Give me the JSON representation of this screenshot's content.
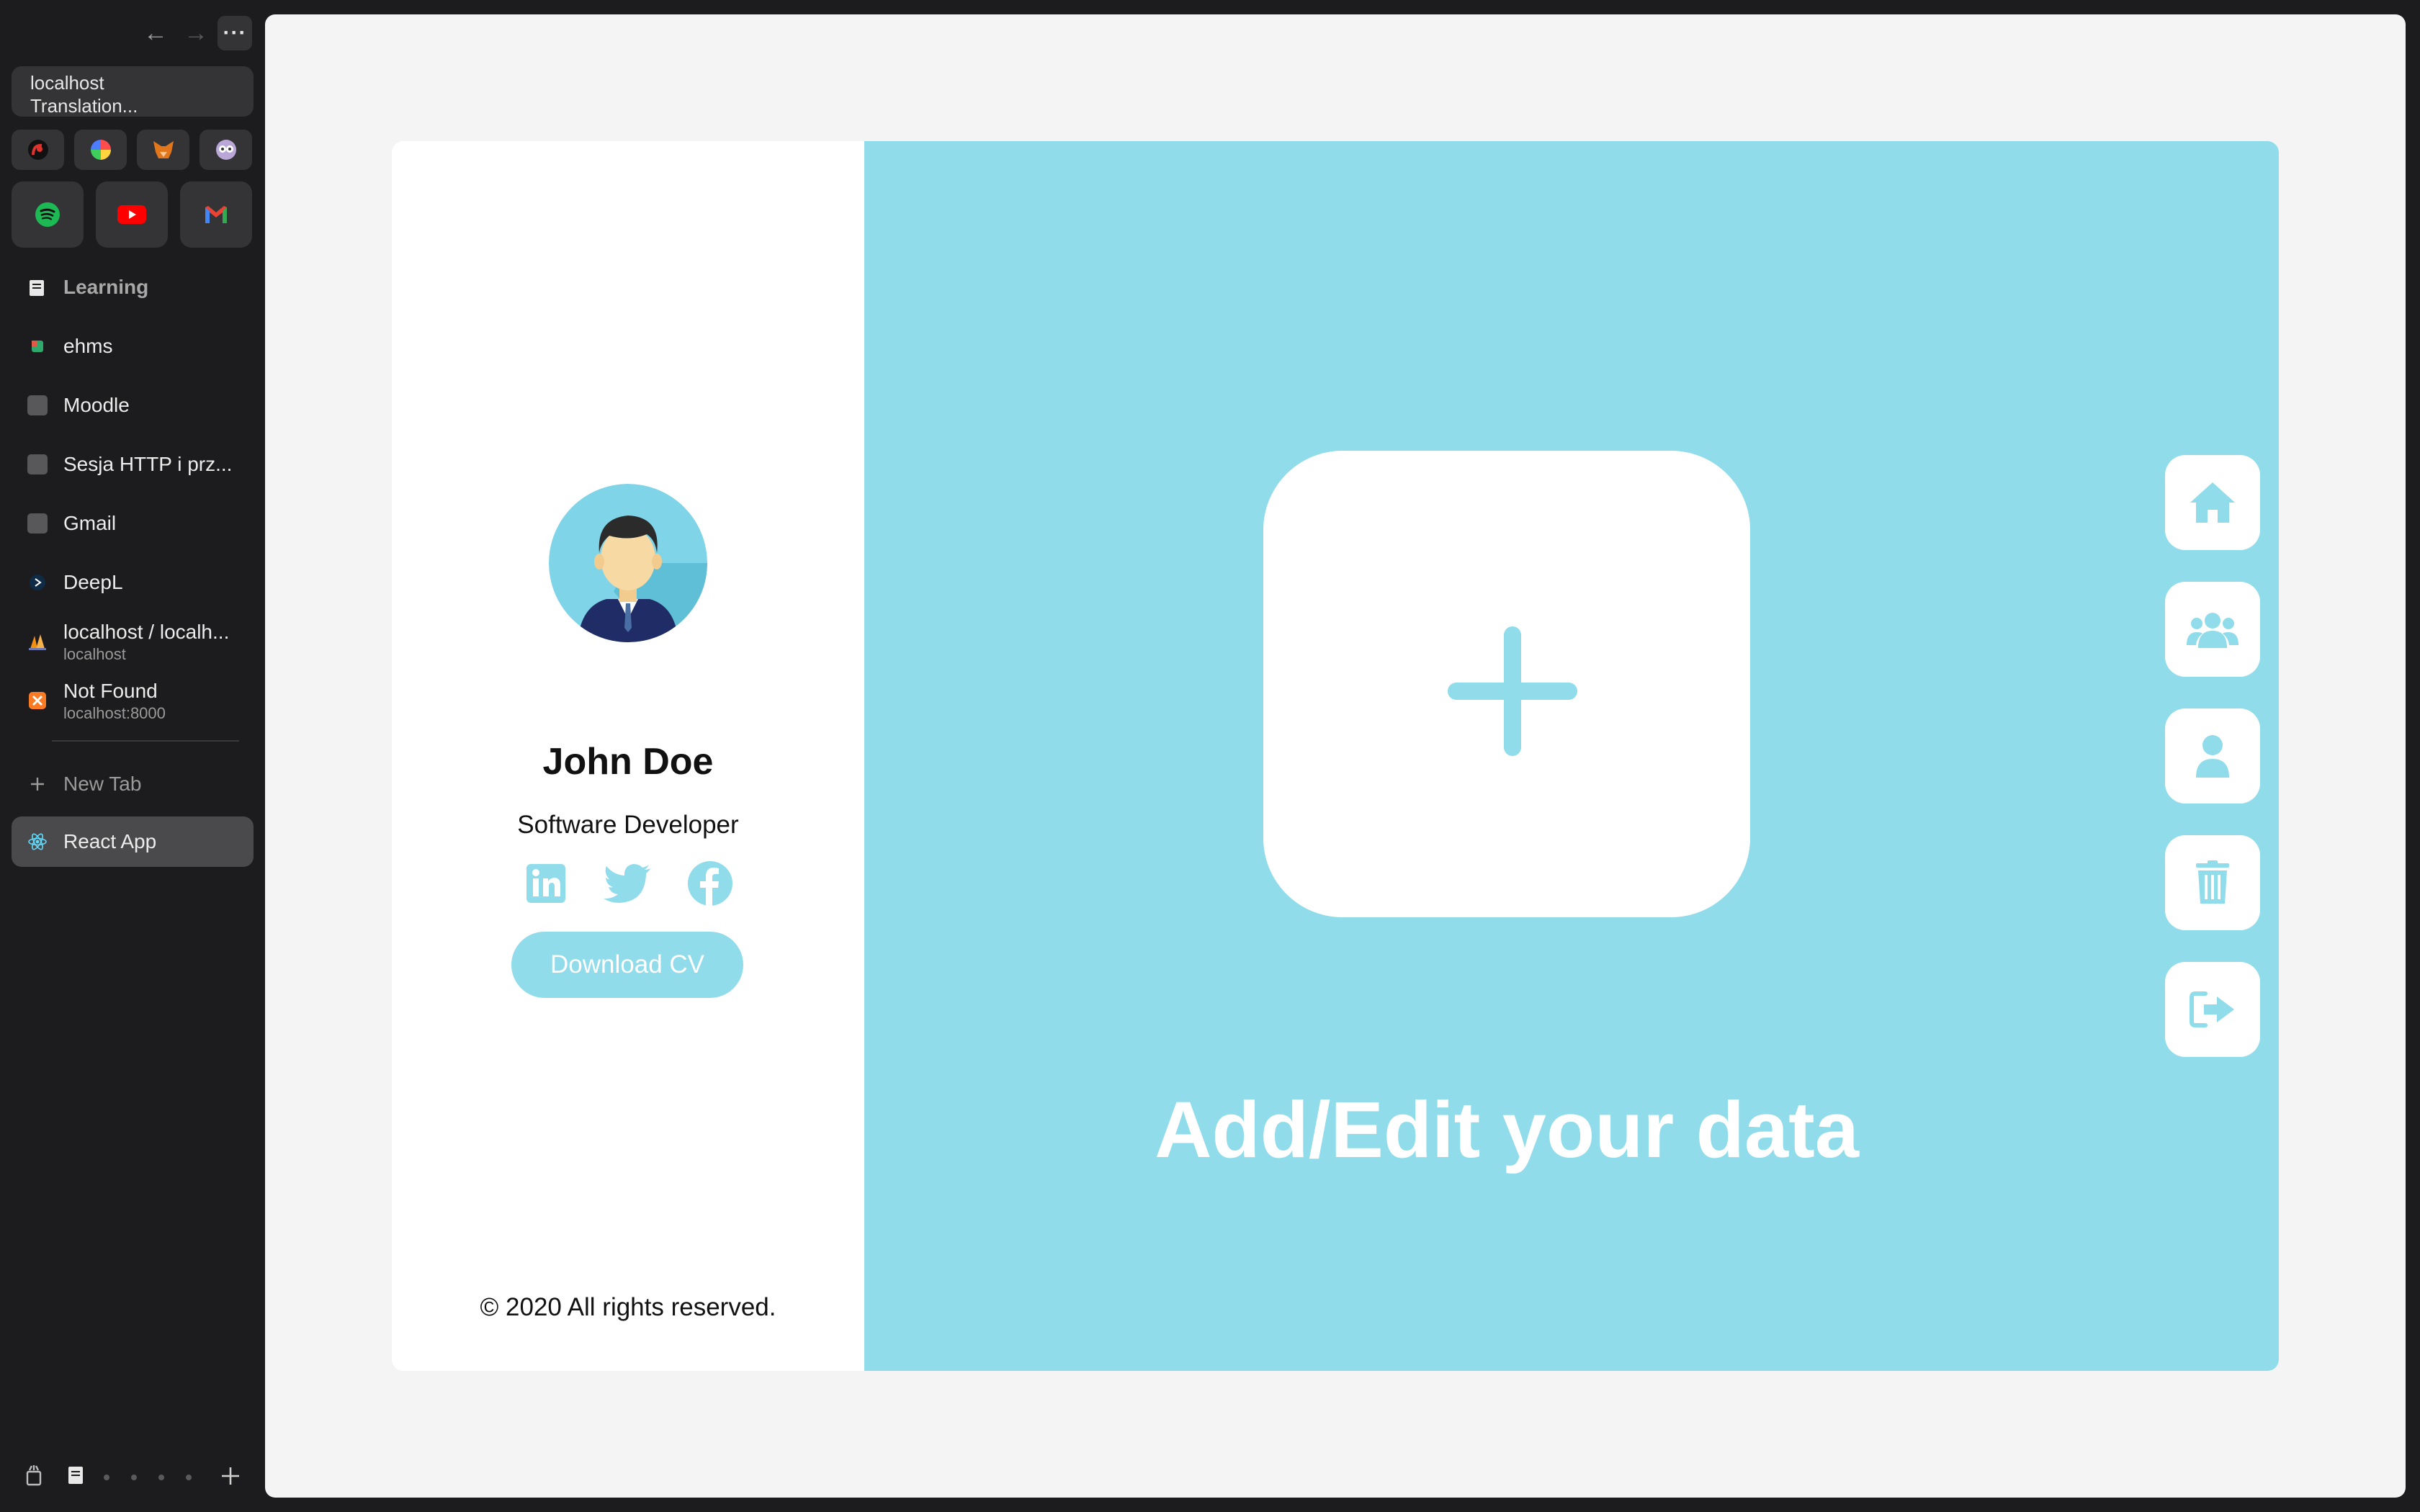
{
  "browser": {
    "url_host": "localhost",
    "url_title": "Translation...",
    "nav": {
      "back": "←",
      "forward": "→",
      "more": "···"
    },
    "favorites": [
      {
        "name": "pocket-casts-icon",
        "color": "#e0312c"
      },
      {
        "name": "colorwheel-icon",
        "color": "#7a5cff"
      },
      {
        "name": "metamask-icon",
        "color": "#e2761b"
      },
      {
        "name": "owl-icon",
        "color": "#b9a7d8"
      }
    ],
    "pinned_apps": [
      {
        "name": "spotify-icon",
        "color": "#1db954"
      },
      {
        "name": "youtube-icon",
        "color": "#ff0000"
      },
      {
        "name": "gmail-icon",
        "color": "#ea4335"
      }
    ],
    "tabs": [
      {
        "title": "Learning",
        "subtitle": "",
        "icon": "folder-icon"
      },
      {
        "title": "ehms",
        "subtitle": "",
        "icon": "ehms-icon"
      },
      {
        "title": "Moodle",
        "subtitle": "",
        "icon": "page-icon"
      },
      {
        "title": "Sesja HTTP i prz...",
        "subtitle": "",
        "icon": "page-icon"
      },
      {
        "title": "Gmail",
        "subtitle": "",
        "icon": "page-icon"
      },
      {
        "title": "DeepL",
        "subtitle": "",
        "icon": "deepl-icon"
      },
      {
        "title": "localhost / localh...",
        "subtitle": "localhost",
        "icon": "phpmyadmin-icon"
      },
      {
        "title": "Not Found",
        "subtitle": "localhost:8000",
        "icon": "xampp-icon"
      }
    ],
    "new_tab_label": "New Tab",
    "active_tab": {
      "title": "React App",
      "icon": "react-icon"
    }
  },
  "profile": {
    "name": "John Doe",
    "role": "Software Developer",
    "download_label": "Download CV",
    "copyright": "© 2020 All rights reserved.",
    "socials": [
      "linkedin-icon",
      "twitter-icon",
      "facebook-icon"
    ]
  },
  "main": {
    "heading": "Add/Edit your data",
    "accent_color": "#90dcea",
    "actions": [
      "home-icon",
      "users-icon",
      "user-icon",
      "trash-icon",
      "logout-icon"
    ]
  }
}
